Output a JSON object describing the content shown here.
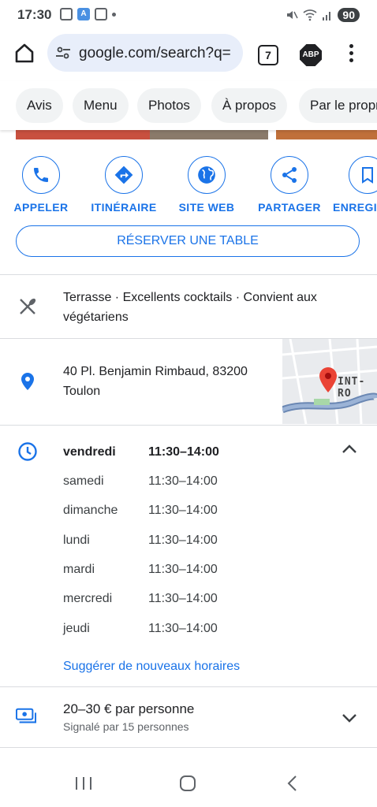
{
  "status_bar": {
    "time": "17:30",
    "battery": "90"
  },
  "browser": {
    "url": "google.com/search?q=",
    "tab_count": "7",
    "abp_label": "ABP"
  },
  "chips": [
    "Avis",
    "Menu",
    "Photos",
    "À propos",
    "Par le propriétaire"
  ],
  "actions": [
    {
      "label": "APPELER",
      "icon": "phone-icon"
    },
    {
      "label": "ITINÉRAIRE",
      "icon": "directions-icon"
    },
    {
      "label": "SITE WEB",
      "icon": "globe-icon"
    },
    {
      "label": "PARTAGER",
      "icon": "share-icon"
    },
    {
      "label": "ENREGISTRER",
      "icon": "bookmark-icon"
    }
  ],
  "reserve_label": "RÉSERVER UNE TABLE",
  "features": "Terrasse · Excellents cocktails · Convient aux végétariens",
  "address": "40 Pl. Benjamin Rimbaud, 83200 Toulon",
  "map_label": "INT-RO",
  "hours": [
    {
      "day": "vendredi",
      "time": "11:30–14:00",
      "today": true
    },
    {
      "day": "samedi",
      "time": "11:30–14:00"
    },
    {
      "day": "dimanche",
      "time": "11:30–14:00"
    },
    {
      "day": "lundi",
      "time": "11:30–14:00"
    },
    {
      "day": "mardi",
      "time": "11:30–14:00"
    },
    {
      "day": "mercredi",
      "time": "11:30–14:00"
    },
    {
      "day": "jeudi",
      "time": "11:30–14:00"
    }
  ],
  "suggest_hours": "Suggérer de nouveaux horaires",
  "price": {
    "range": "20–30 € par personne",
    "reported": "Signalé par 15 personnes"
  },
  "colors": {
    "accent": "#1a73e8",
    "pin": "#ea4335"
  }
}
